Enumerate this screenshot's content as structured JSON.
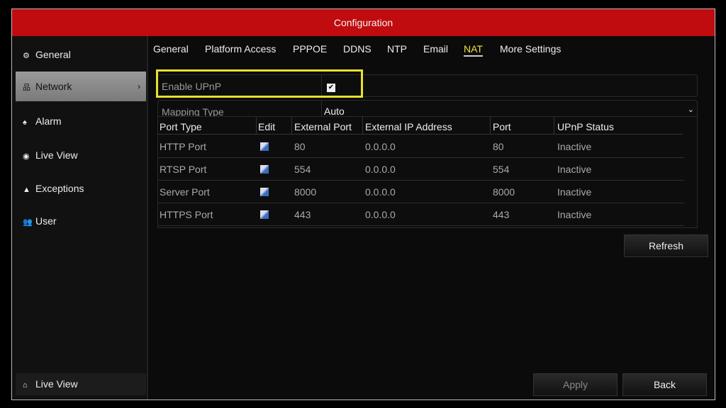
{
  "title": "Configuration",
  "sidebar": {
    "items": [
      {
        "label": "General",
        "icon": "gear-icon"
      },
      {
        "label": "Network",
        "icon": "network-icon",
        "selected": true
      },
      {
        "label": "Alarm",
        "icon": "alarm-icon"
      },
      {
        "label": "Live View",
        "icon": "eye-icon"
      },
      {
        "label": "Exceptions",
        "icon": "warning-icon"
      },
      {
        "label": "User",
        "icon": "user-icon"
      }
    ],
    "bottom": {
      "label": "Live View",
      "icon": "home-icon"
    }
  },
  "tabs": [
    {
      "label": "General"
    },
    {
      "label": "Platform Access"
    },
    {
      "label": "PPPOE"
    },
    {
      "label": "DDNS"
    },
    {
      "label": "NTP"
    },
    {
      "label": "Email"
    },
    {
      "label": "NAT",
      "active": true
    },
    {
      "label": "More Settings"
    }
  ],
  "form": {
    "enable_upnp_label": "Enable UPnP",
    "enable_upnp": true,
    "mapping_type_label": "Mapping Type",
    "mapping_type": "Auto"
  },
  "table": {
    "headers": [
      "Port Type",
      "Edit",
      "External Port",
      "External IP Address",
      "Port",
      "UPnP Status"
    ],
    "rows": [
      [
        "HTTP Port",
        "",
        "80",
        "0.0.0.0",
        "80",
        "Inactive"
      ],
      [
        "RTSP Port",
        "",
        "554",
        "0.0.0.0",
        "554",
        "Inactive"
      ],
      [
        "Server Port",
        "",
        "8000",
        "0.0.0.0",
        "8000",
        "Inactive"
      ],
      [
        "HTTPS Port",
        "",
        "443",
        "0.0.0.0",
        "443",
        "Inactive"
      ]
    ]
  },
  "buttons": {
    "refresh": "Refresh",
    "apply": "Apply",
    "back": "Back"
  },
  "colors": {
    "header": "#c00b0f",
    "highlight": "#e8e02c",
    "active_tab": "#f2e23a"
  }
}
